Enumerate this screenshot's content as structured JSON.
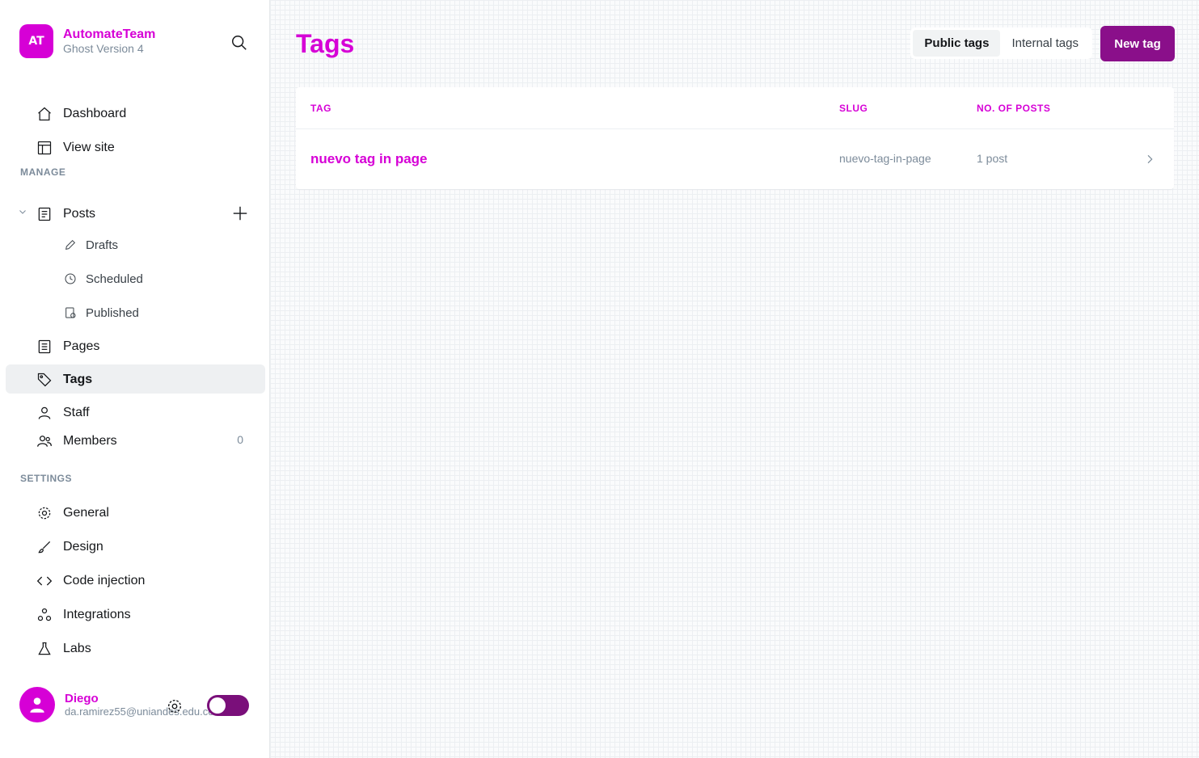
{
  "brand": {
    "logo_text": "AT",
    "name": "AutomateTeam",
    "subtitle": "Ghost Version 4"
  },
  "nav": {
    "dashboard": "Dashboard",
    "view_site": "View site",
    "manage_title": "MANAGE",
    "posts": "Posts",
    "drafts": "Drafts",
    "scheduled": "Scheduled",
    "published": "Published",
    "pages": "Pages",
    "tags": "Tags",
    "staff": "Staff",
    "members": "Members",
    "members_count": "0",
    "settings_title": "SETTINGS",
    "general": "General",
    "design": "Design",
    "code_injection": "Code injection",
    "integrations": "Integrations",
    "labs": "Labs"
  },
  "user": {
    "name": "Diego",
    "email": "da.ramirez55@uniandes.edu.co"
  },
  "header": {
    "title": "Tags",
    "tab_public": "Public tags",
    "tab_internal": "Internal tags",
    "new_tag": "New tag"
  },
  "table": {
    "columns": {
      "tag": "TAG",
      "slug": "SLUG",
      "posts": "NO. OF POSTS"
    },
    "rows": [
      {
        "name": "nuevo tag in page",
        "slug": "nuevo-tag-in-page",
        "posts": "1 post"
      }
    ]
  },
  "colors": {
    "accent": "#d600d6",
    "button": "#8a0f8a",
    "active_bg": "#eef0f2"
  }
}
